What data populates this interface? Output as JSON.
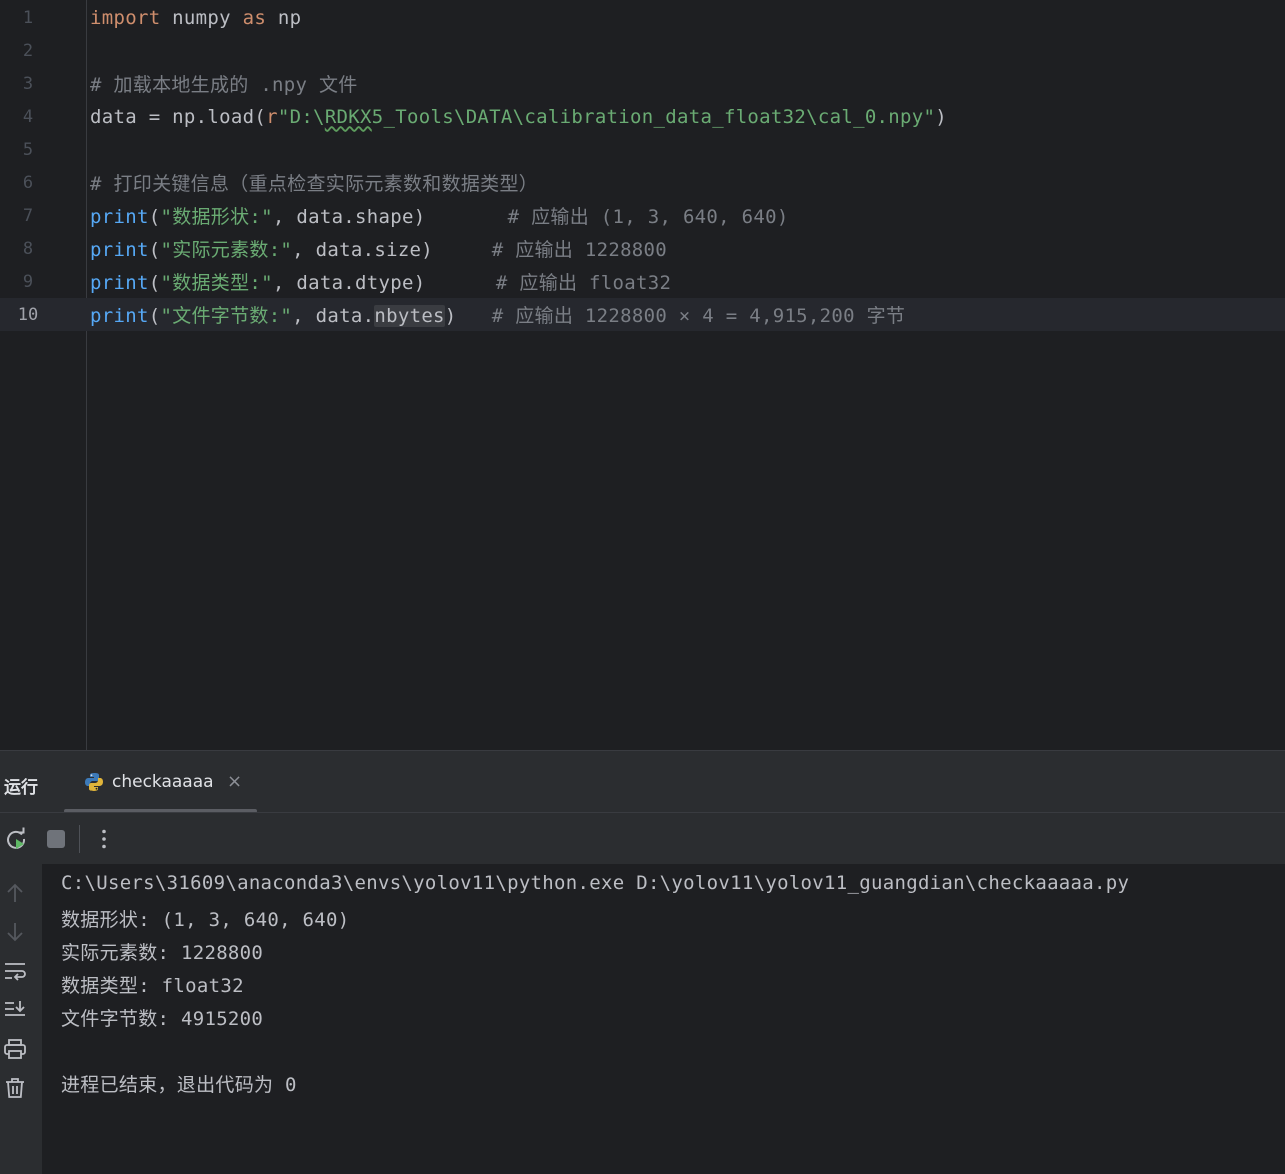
{
  "editor": {
    "lines": [
      {
        "num": "1",
        "tokens": [
          [
            "kw",
            "import"
          ],
          [
            "plain",
            " numpy "
          ],
          [
            "kw",
            "as"
          ],
          [
            "plain",
            " np"
          ]
        ]
      },
      {
        "num": "2",
        "tokens": []
      },
      {
        "num": "3",
        "tokens": [
          [
            "cmt",
            "# 加载本地生成的 .npy 文件"
          ]
        ]
      },
      {
        "num": "4",
        "tokens": [
          [
            "plain",
            "data = np.load("
          ],
          [
            "kw",
            "r"
          ],
          [
            "str",
            "\"D:\\"
          ],
          [
            "str typo",
            "RDKX"
          ],
          [
            "str",
            "5_Tools\\DATA\\calibration_data_float32\\cal_0.npy\""
          ],
          [
            "plain",
            ")"
          ]
        ]
      },
      {
        "num": "5",
        "tokens": []
      },
      {
        "num": "6",
        "tokens": [
          [
            "cmt",
            "# 打印关键信息（重点检查实际元素数和数据类型）"
          ]
        ]
      },
      {
        "num": "7",
        "tokens": [
          [
            "fn",
            "print"
          ],
          [
            "plain",
            "("
          ],
          [
            "str",
            "\"数据形状:\""
          ],
          [
            "plain",
            ", data.shape)       "
          ],
          [
            "cmt",
            "# 应输出 (1, 3, 640, 640)"
          ]
        ]
      },
      {
        "num": "8",
        "tokens": [
          [
            "fn",
            "print"
          ],
          [
            "plain",
            "("
          ],
          [
            "str",
            "\"实际元素数:\""
          ],
          [
            "plain",
            ", data.size)     "
          ],
          [
            "cmt",
            "# 应输出 1228800"
          ]
        ]
      },
      {
        "num": "9",
        "tokens": [
          [
            "fn",
            "print"
          ],
          [
            "plain",
            "("
          ],
          [
            "str",
            "\"数据类型:\""
          ],
          [
            "plain",
            ", data.dtype)      "
          ],
          [
            "cmt",
            "# 应输出 float32"
          ]
        ]
      },
      {
        "num": "10",
        "tokens": [
          [
            "fn",
            "print"
          ],
          [
            "plain",
            "("
          ],
          [
            "str",
            "\"文件字节数:\""
          ],
          [
            "plain",
            ", data."
          ],
          [
            "plain hl",
            "nbytes"
          ],
          [
            "plain",
            ")   "
          ],
          [
            "cmt",
            "# 应输出 1228800 × 4 = 4,915,200 字节"
          ]
        ]
      }
    ],
    "current_line": 10
  },
  "run_panel": {
    "title": "运行",
    "tab_label": "checkaaaaa",
    "close_glyph": "×"
  },
  "console": {
    "lines": [
      "C:\\Users\\31609\\anaconda3\\envs\\yolov11\\python.exe D:\\yolov11\\yolov11_guangdian\\checkaaaaa.py",
      "数据形状: (1, 3, 640, 640)",
      "实际元素数: 1228800",
      "数据类型: float32",
      "文件字节数: 4915200",
      "",
      "进程已结束，退出代码为 0"
    ]
  },
  "colors": {
    "background": "#1e1f22",
    "panel": "#2b2d30",
    "keyword": "#cf8e6d",
    "function": "#56a8f5",
    "string": "#6aab73",
    "comment": "#7a7e85"
  }
}
